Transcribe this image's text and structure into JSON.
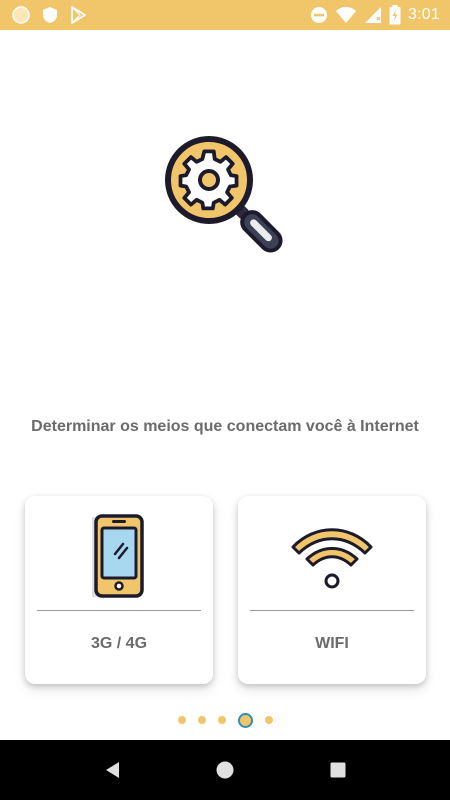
{
  "status_bar": {
    "time": "3:01",
    "background": "#F1C66B",
    "left_icons": [
      "circle-notification-icon",
      "shield-icon",
      "play-store-icon"
    ],
    "right_icons": [
      "do-not-disturb-icon",
      "wifi-icon",
      "signal-icon",
      "battery-charging-icon"
    ]
  },
  "hero": {
    "icon": "magnifier-gear-icon"
  },
  "subtitle": "Determinar os meios que conectam você à Internet",
  "options": [
    {
      "label": "3G / 4G",
      "icon": "smartphone-icon"
    },
    {
      "label": "WIFI",
      "icon": "wifi-icon"
    }
  ],
  "pager": {
    "total": 5,
    "active_index": 3,
    "dot_color": "#F1C66B",
    "active_ring_color": "#2f8fb5"
  },
  "nav_bar": {
    "buttons": [
      "back-icon",
      "home-icon",
      "recent-apps-icon"
    ]
  }
}
